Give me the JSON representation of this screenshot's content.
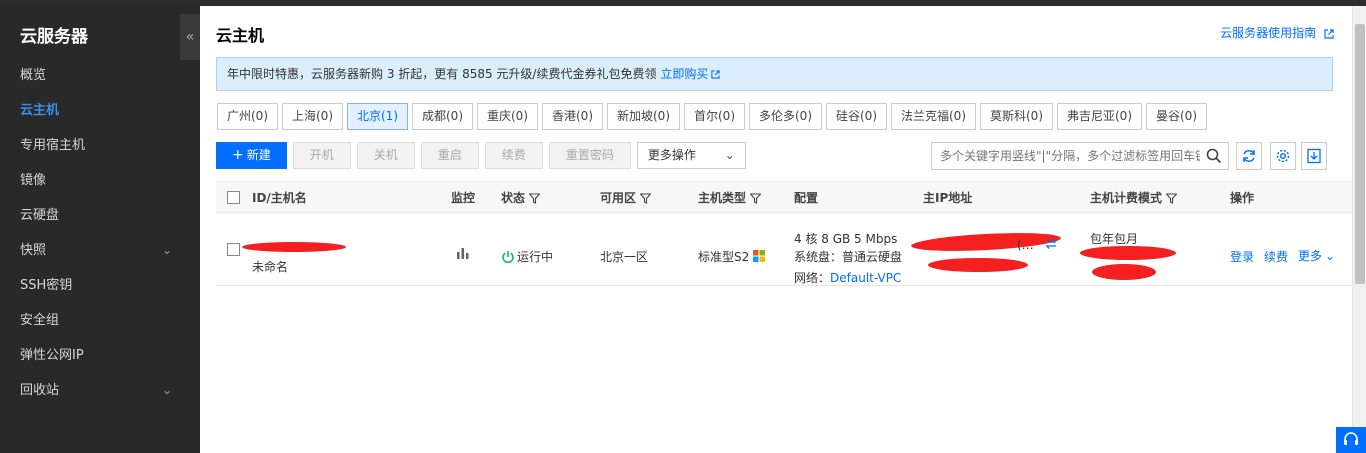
{
  "sidebar": {
    "title": "云服务器",
    "collapse_glyph": "«",
    "items": [
      {
        "label": "概览"
      },
      {
        "label": "云主机",
        "active": true
      },
      {
        "label": "专用宿主机"
      },
      {
        "label": "镜像"
      },
      {
        "label": "云硬盘"
      },
      {
        "label": "快照",
        "expandable": true
      },
      {
        "label": "SSH密钥"
      },
      {
        "label": "安全组"
      },
      {
        "label": "弹性公网IP"
      },
      {
        "label": "回收站",
        "expandable": true
      }
    ]
  },
  "header": {
    "title": "云主机",
    "guide_link": "云服务器使用指南"
  },
  "banner": {
    "text": "年中限时特惠，云服务器新购 3 折起，更有 8585 元升级/续费代金券礼包免费领",
    "link": "立即购买"
  },
  "regions": [
    "广州(0)",
    "上海(0)",
    "北京(1)",
    "成都(0)",
    "重庆(0)",
    "香港(0)",
    "新加坡(0)",
    "首尔(0)",
    "多伦多(0)",
    "硅谷(0)",
    "法兰克福(0)",
    "莫斯科(0)",
    "弗吉尼亚(0)",
    "曼谷(0)"
  ],
  "active_region_index": 2,
  "toolbar": {
    "new_label": "新建",
    "start_label": "开机",
    "stop_label": "关机",
    "restart_label": "重启",
    "renew_label": "续费",
    "reset_pwd_label": "重置密码",
    "more_ops_label": "更多操作"
  },
  "search": {
    "placeholder": "多个关键字用竖线\"|\"分隔，多个过滤标签用回车键分隔"
  },
  "table": {
    "headers": {
      "id": "ID/主机名",
      "monitor": "监控",
      "status": "状态",
      "zone": "可用区",
      "type": "主机类型",
      "config": "配置",
      "ip": "主IP地址",
      "billing": "主机计费模式",
      "ops": "操作"
    },
    "rows": [
      {
        "name": "未命名",
        "status": "运行中",
        "zone": "北京一区",
        "type": "标准型S2",
        "config_line1": "4 核 8 GB 5 Mbps",
        "config_line2": "系统盘：普通云硬盘",
        "config_line3_label": "网络：",
        "config_line3_link": "Default-VPC",
        "ip_suffix": "(…",
        "billing": "包年包月",
        "op_login": "登录",
        "op_renew": "续费",
        "op_more": "更多"
      }
    ]
  },
  "colors": {
    "accent": "#006eff",
    "sidebar_bg": "#292929",
    "running": "#0abf5b"
  }
}
